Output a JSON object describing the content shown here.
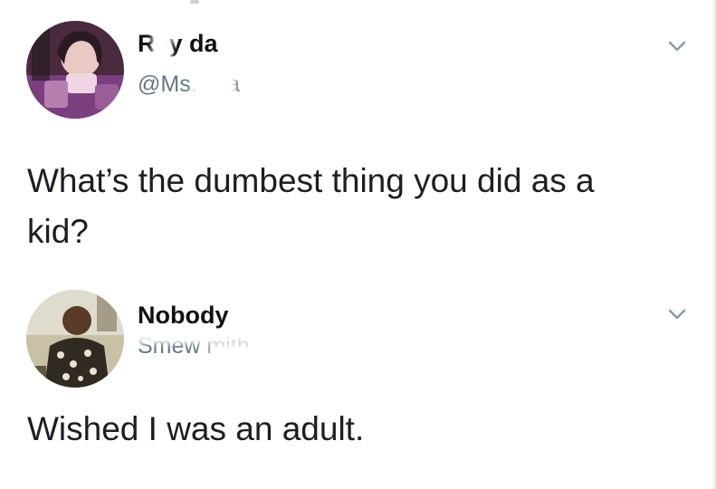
{
  "tweets": [
    {
      "display_name": "Rey da",
      "handle": "@Ms. vua",
      "text": "What’s the dumbest thing you did as a\nkid?",
      "avatar_icon": "user-avatar-photo",
      "menu_icon": "chevron-down-icon"
    },
    {
      "display_name": "Nobody",
      "handle": "Smew mith",
      "text": "Wished I was an adult.",
      "avatar_icon": "user-avatar-photo",
      "menu_icon": "chevron-down-icon"
    }
  ],
  "colors": {
    "background": "#ffffff",
    "text": "#14171a",
    "secondary_text": "#657786",
    "avatar_1_tint": "#6b2d6e",
    "avatar_2_tint": "#3f3a2f"
  }
}
